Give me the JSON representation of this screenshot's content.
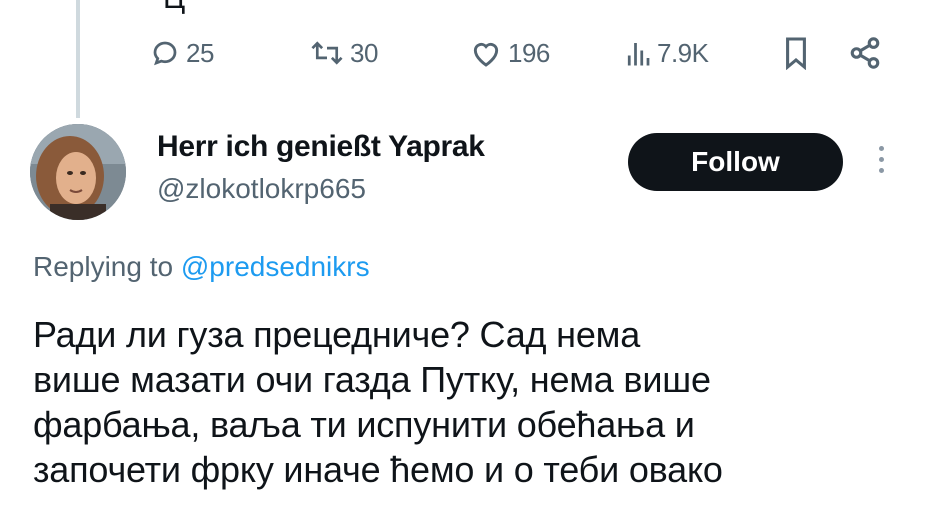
{
  "tweet_actions": {
    "replies": "25",
    "reposts": "30",
    "likes": "196",
    "views": "7.9K"
  },
  "reply": {
    "display_name": "Herr ich genießt Yaprak",
    "handle": "@zlokotlokrp665",
    "follow_label": "Follow",
    "replying_prefix": "Replying to",
    "replying_mention": "@predsednikrs",
    "text_lines": [
      "Ради ли гуза прецедниче? Сад нема",
      "више мазати очи газда Путку, нема више",
      "фарбања, ваља ти испунити обећања и",
      "започети фрку иначе ћемо и о теби овако"
    ]
  },
  "colors": {
    "text_primary": "#0f1419",
    "text_secondary": "#536471",
    "link": "#1d9bf0",
    "follow_button_bg": "#0f1419",
    "follow_button_text": "#ffffff",
    "thread_line": "#cfd9de"
  },
  "icons": [
    "reply-icon",
    "repost-icon",
    "like-icon",
    "views-icon",
    "bookmark-icon",
    "share-icon",
    "more-icon"
  ]
}
